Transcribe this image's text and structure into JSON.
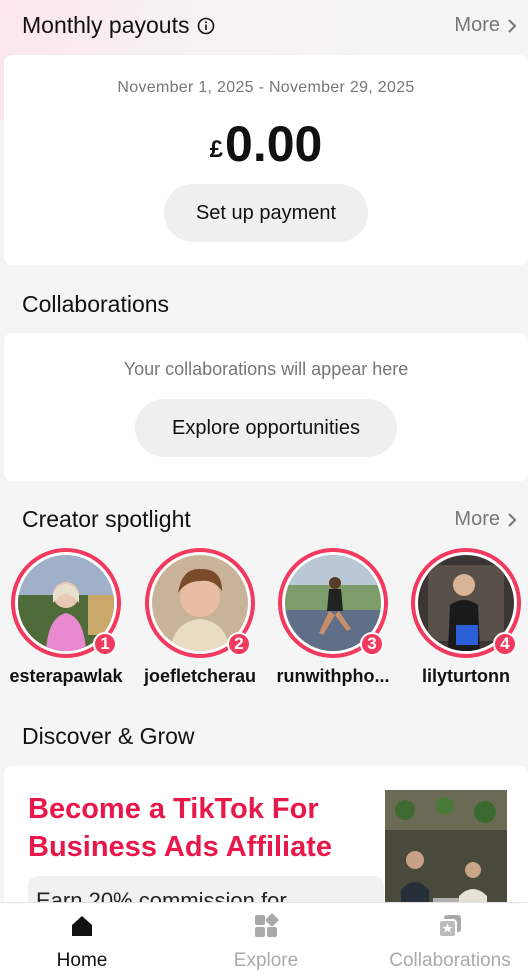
{
  "payouts": {
    "title": "Monthly payouts",
    "more_label": "More",
    "period": "November 1, 2025 - November 29, 2025",
    "currency": "£",
    "amount": "0.00",
    "setup_button": "Set up payment"
  },
  "collaborations": {
    "title": "Collaborations",
    "empty_message": "Your collaborations will appear here",
    "explore_button": "Explore opportunities"
  },
  "spotlight": {
    "title": "Creator spotlight",
    "more_label": "More",
    "creators": [
      {
        "rank": "1",
        "name": "esterapawlak"
      },
      {
        "rank": "2",
        "name": "joefletcherau"
      },
      {
        "rank": "3",
        "name": "runwithpho..."
      },
      {
        "rank": "4",
        "name": "lilyturtonn"
      }
    ]
  },
  "discover": {
    "title": "Discover & Grow",
    "promo_title": "Become a TikTok For Business Ads Affiliate",
    "promo_subtitle": "Earn 20% commission for"
  },
  "nav": {
    "items": [
      {
        "label": "Home",
        "icon": "home-icon",
        "active": true
      },
      {
        "label": "Explore",
        "icon": "explore-icon",
        "active": false
      },
      {
        "label": "Collaborations",
        "icon": "collaborations-icon",
        "active": false
      }
    ]
  },
  "colors": {
    "accent": "#f23a5e",
    "promo": "#e8194a",
    "muted": "#777777"
  }
}
